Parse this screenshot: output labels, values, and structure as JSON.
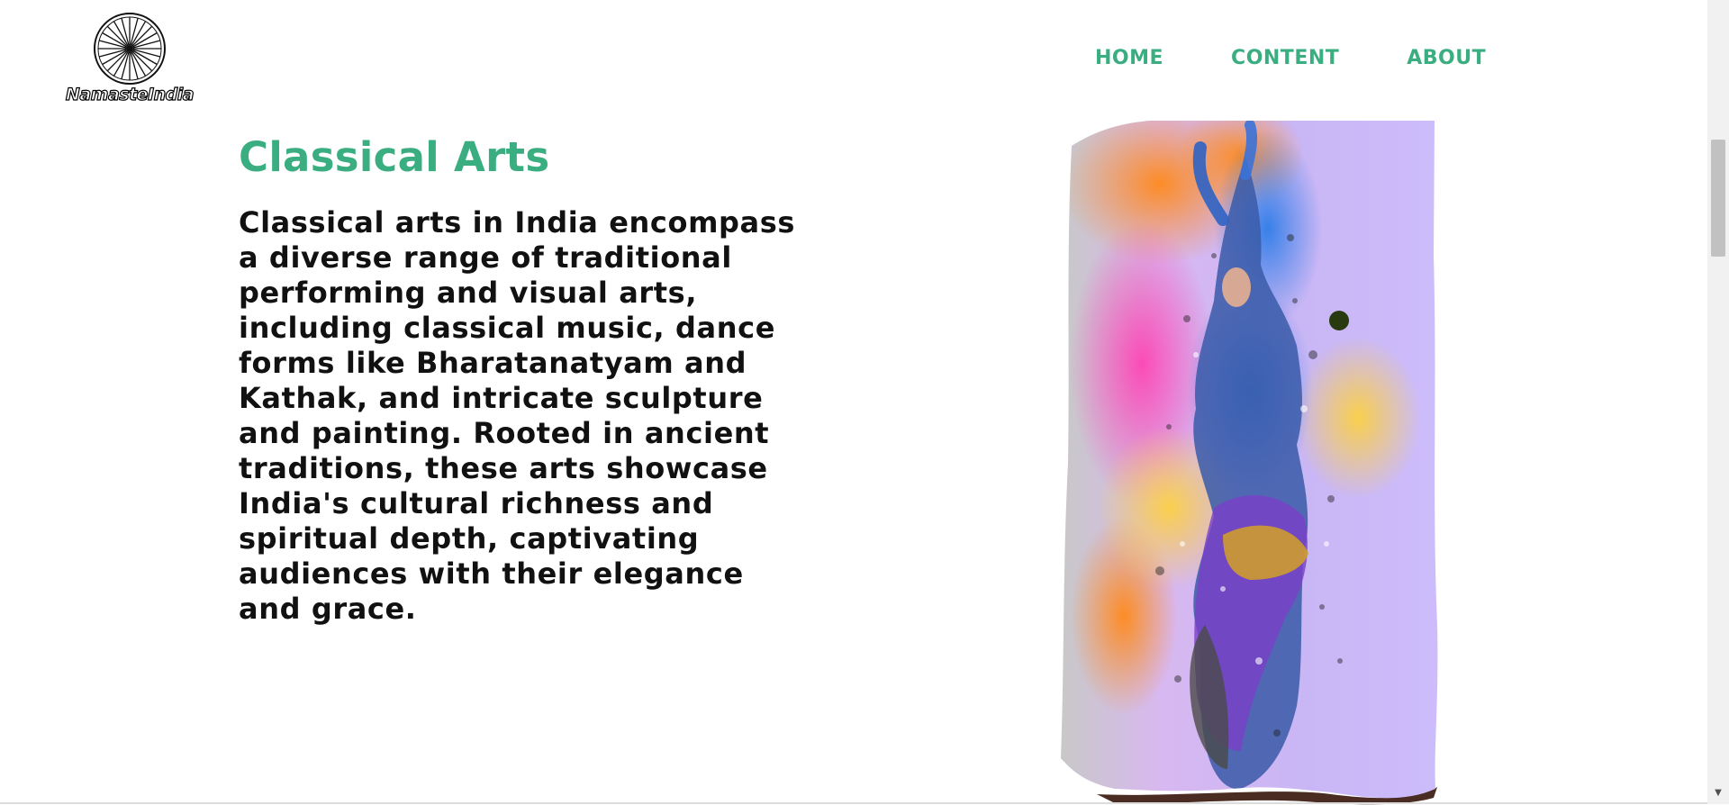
{
  "brand": {
    "name": "NamasteIndia",
    "icon": "dharma-wheel-icon"
  },
  "nav": {
    "home": "HOME",
    "content": "CONTENT",
    "about": "ABOUT"
  },
  "main": {
    "title": "Classical Arts",
    "description": "Classical arts in India encompass a diverse range of traditional performing and visual arts, including classical music, dance forms like Bharatanatyam and Kathak, and intricate sculpture and painting. Rooted in ancient traditions, these arts showcase India's cultural richness and spiritual depth, captivating audiences with their elegance and grace."
  },
  "colors": {
    "accent": "#3aae80",
    "text": "#111111",
    "background": "#ffffff"
  },
  "image": {
    "subject": "colorful dancer painting"
  }
}
